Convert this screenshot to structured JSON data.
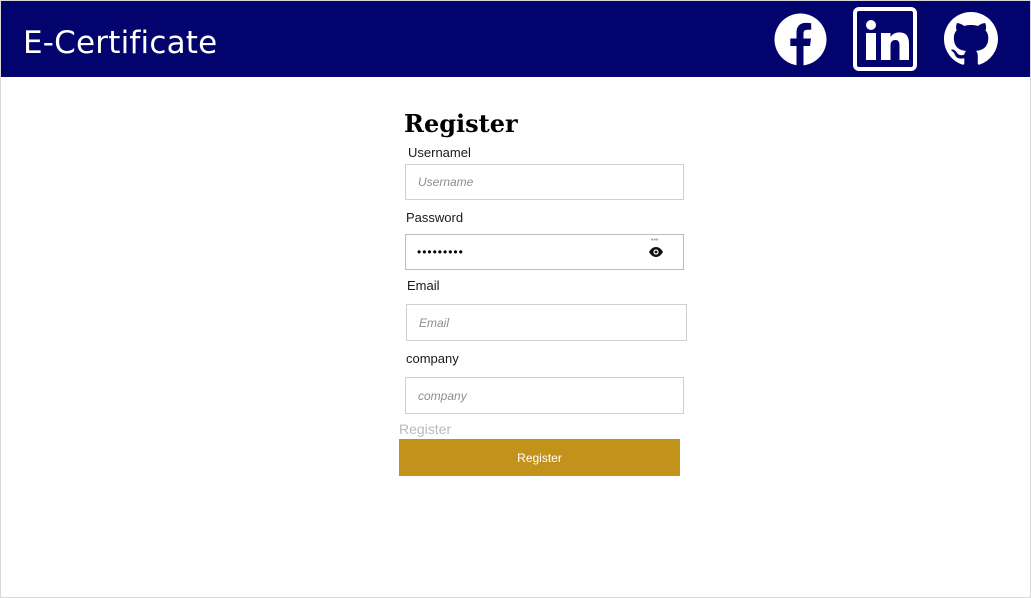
{
  "header": {
    "brand": "E-Certificate",
    "social": [
      {
        "icon": "facebook-icon"
      },
      {
        "icon": "linkedin-icon"
      },
      {
        "icon": "github-icon"
      }
    ],
    "background_color": "#03036e"
  },
  "form": {
    "title": "Register",
    "username_label": "Usernamel",
    "username_placeholder": "Username",
    "password_label": "Password",
    "password_value": "•••••••••",
    "email_label": "Email",
    "email_placeholder": "Email",
    "company_label": "company",
    "company_placeholder": "company",
    "ghost_text": "Register",
    "submit_label": "Register",
    "submit_color": "#c3921a"
  }
}
